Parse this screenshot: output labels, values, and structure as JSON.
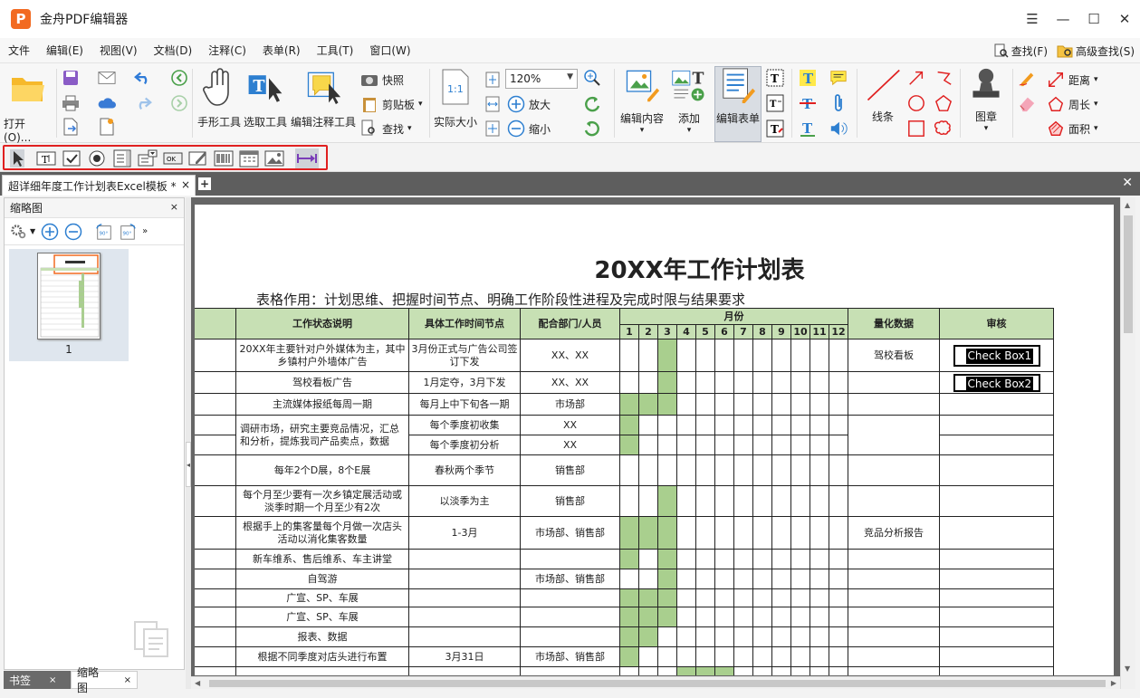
{
  "app": {
    "title": "金舟PDF编辑器",
    "logo": "P"
  },
  "window": {
    "minimize": "—",
    "maximize": "☐",
    "close": "✕",
    "restore": "☰"
  },
  "menu": [
    "文件",
    "编辑(E)",
    "视图(V)",
    "文档(D)",
    "注释(C)",
    "表单(R)",
    "工具(T)",
    "窗口(W)"
  ],
  "menu_right": {
    "find": "查找(F)",
    "adv_find": "高级查找(S)"
  },
  "ribbon": {
    "open": "打开(O)...",
    "hand": "手形工具",
    "select": "选取工具",
    "edit_annot": "编辑注释工具",
    "snapshot": "快照",
    "clipboard": "剪贴板",
    "find": "查找",
    "actual_size": "实际大小",
    "zoom_value": "120%",
    "zoom_in": "放大",
    "zoom_out": "缩小",
    "edit_content": "编辑内容",
    "add": "添加",
    "edit_form": "编辑表单",
    "line": "线条",
    "stamp": "图章",
    "distance": "距离",
    "perimeter": "周长",
    "area": "面积"
  },
  "tab": {
    "name": "超详细年度工作计划表Excel模板 *",
    "close": "×",
    "add": "+",
    "close_all": "✕"
  },
  "left_panel": {
    "title": "缩略图",
    "close": "×",
    "page_num": "1"
  },
  "bottom_tabs": [
    {
      "label": "书签",
      "close": "×"
    },
    {
      "label": "缩略图",
      "close": "×"
    }
  ],
  "document": {
    "title": "20XX年工作计划表",
    "subtitle": "表格作用：计划思维、把握时间节点、明确工作阶段性进程及完成时限与结果要求",
    "headers": {
      "status": "工作状态说明",
      "time": "具体工作时间节点",
      "dept": "配合部门/人员",
      "month": "月份",
      "quant": "量化数据",
      "review": "审核"
    },
    "months": [
      "1",
      "2",
      "3",
      "4",
      "5",
      "6",
      "7",
      "8",
      "9",
      "10",
      "11",
      "12"
    ],
    "checkbox1": "Check Box1",
    "checkbox2": "Check Box2",
    "rows": [
      {
        "status": "20XX年主要针对户外媒体为主，其中乡镇村户外墙体广告",
        "time": "3月份正式与广告公司签订下发",
        "dept": "XX、XX",
        "quant": "驾校看板"
      },
      {
        "status": "驾校看板广告",
        "time": "1月定夺，3月下发",
        "dept": "XX、XX",
        "quant": ""
      },
      {
        "status": "主流媒体报纸每周一期",
        "time": "每月上中下旬各一期",
        "dept": "市场部",
        "quant": ""
      },
      {
        "status": "调研市场，研究主要竞品情况，汇总和分析，提炼我司产品卖点，数据",
        "time": "每个季度初收集",
        "dept": "XX",
        "quant": ""
      },
      {
        "status": "",
        "time": "每个季度初分析",
        "dept": "XX",
        "quant": ""
      },
      {
        "status": "每年2个D展，8个E展",
        "time": "春秋两个季节",
        "dept": "销售部",
        "quant": ""
      },
      {
        "status": "每个月至少要有一次乡镇定展活动或淡季时期一个月至少有2次",
        "time": "以淡季为主",
        "dept": "销售部",
        "quant": ""
      },
      {
        "status": "根据手上的集客量每个月做一次店头活动以消化集客数量",
        "time": "1-3月",
        "dept": "市场部、销售部",
        "quant": "竞品分析报告"
      },
      {
        "status": "新车维系、售后维系、车主讲堂",
        "time": "",
        "dept": "",
        "quant": ""
      },
      {
        "status": "自驾游",
        "time": "",
        "dept": "市场部、销售部",
        "quant": ""
      },
      {
        "status": "广宣、SP、车展",
        "time": "",
        "dept": "",
        "quant": ""
      },
      {
        "status": "广宣、SP、车展",
        "time": "",
        "dept": "",
        "quant": ""
      },
      {
        "status": "报表、数据",
        "time": "",
        "dept": "",
        "quant": ""
      },
      {
        "status": "根据不同季度对店头进行布置",
        "time": "3月31日",
        "dept": "市场部、销售部",
        "quant": ""
      }
    ],
    "highlight": [
      [
        3
      ],
      [
        3
      ],
      [
        1,
        2,
        3
      ],
      [
        1
      ],
      [
        1
      ],
      [],
      [
        3
      ],
      [
        1,
        2,
        3
      ],
      [
        1,
        3
      ],
      [
        3
      ],
      [
        1,
        2,
        3
      ],
      [
        1,
        2,
        3
      ],
      [
        1,
        2
      ],
      [
        1
      ],
      [
        4,
        5,
        6
      ]
    ]
  },
  "colors": {
    "accent": "#f26a21",
    "header_green": "#c7e0b4",
    "cell_green": "#a9cf8e",
    "highlight_red": "#e02020"
  }
}
